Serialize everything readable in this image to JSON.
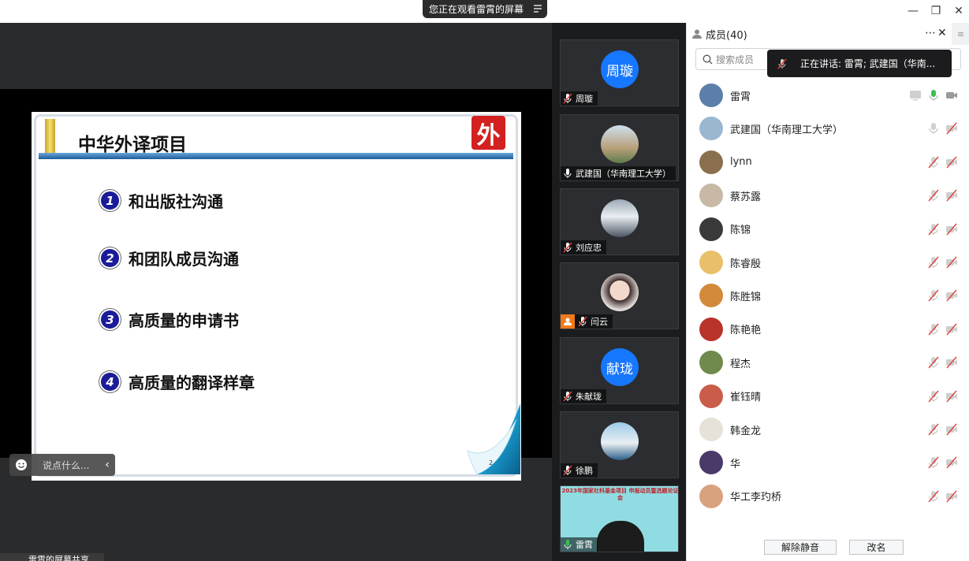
{
  "window": {
    "viewing_banner": "您正在观看雷霄的屏幕",
    "controls": [
      "minimize",
      "restore",
      "close"
    ]
  },
  "slide": {
    "title": "中华外译项目",
    "logo_text": "外",
    "bullets": [
      {
        "num": "1",
        "text": "和出版社沟通"
      },
      {
        "num": "2",
        "text": "和团队成员沟通"
      },
      {
        "num": "3",
        "text": "高质量的申请书"
      },
      {
        "num": "4",
        "text": "高质量的翻译样章"
      }
    ],
    "page_number": "2"
  },
  "chat": {
    "placeholder": "说点什么..."
  },
  "share_status": "雷霄的屏幕共享",
  "video_tiles": [
    {
      "name": "周璇",
      "avatar_text": "周璇",
      "avatar_color": "#1677ff",
      "mic": "muted"
    },
    {
      "name": "武建国（华南理工大学）",
      "avatar_text": "",
      "avatar_color": "#9bb7d0",
      "mic": "on"
    },
    {
      "name": "刘应忠",
      "avatar_text": "",
      "avatar_color": "#7c8a99",
      "mic": "muted"
    },
    {
      "name": "闫云",
      "avatar_text": "",
      "avatar_color": "#d9c2b8",
      "mic": "muted"
    },
    {
      "name": "朱献珑",
      "avatar_text": "献珑",
      "avatar_color": "#1677ff",
      "mic": "muted"
    },
    {
      "name": "徐鹏",
      "avatar_text": "",
      "avatar_color": "#3b79b5",
      "mic": "muted"
    },
    {
      "name": "雷霄",
      "avatar_text": "",
      "avatar_color": "#7fd1d8",
      "mic": "on",
      "video_banner": "2023年国家社科基金项目 申报动员暨选题论证会"
    }
  ],
  "members": {
    "header": "成员(40)",
    "search_placeholder": "搜索成员",
    "speaking_tip": "正在讲话: 雷霄; 武建国（华南...",
    "list": [
      {
        "name": "雷霄",
        "avatar_color": "#5b7fa8",
        "mic": "on",
        "video": "on",
        "screen": true
      },
      {
        "name": "武建国（华南理工大学）",
        "avatar_color": "#9bb7d0",
        "mic": "off",
        "video": "off"
      },
      {
        "name": "lynn",
        "avatar_color": "#8a6f4e",
        "mic": "off",
        "video": "off"
      },
      {
        "name": "蔡苏露",
        "avatar_color": "#c7b9a6",
        "mic": "off",
        "video": "off"
      },
      {
        "name": "陈锦",
        "avatar_color": "#3a3a3a",
        "mic": "off",
        "video": "off"
      },
      {
        "name": "陈睿殷",
        "avatar_color": "#e8c06a",
        "mic": "off",
        "video": "off"
      },
      {
        "name": "陈胜锦",
        "avatar_color": "#d28a3a",
        "mic": "off",
        "video": "off"
      },
      {
        "name": "陈艳艳",
        "avatar_color": "#b8342b",
        "mic": "off",
        "video": "off"
      },
      {
        "name": "程杰",
        "avatar_color": "#6f8a4c",
        "mic": "off",
        "video": "off"
      },
      {
        "name": "崔钰晴",
        "avatar_color": "#c95d4a",
        "mic": "off",
        "video": "off"
      },
      {
        "name": "韩金龙",
        "avatar_color": "#e6e2d8",
        "mic": "off",
        "video": "off"
      },
      {
        "name": "华",
        "avatar_color": "#4a3a6a",
        "mic": "off",
        "video": "off"
      },
      {
        "name": "华工李玓桥",
        "avatar_color": "#d8a27f",
        "mic": "off",
        "video": "off"
      }
    ]
  },
  "footer": {
    "unmute_all": "解除静音",
    "rename": "改名"
  },
  "colors": {
    "mic_on": "#3bbf55",
    "mic_off": "#e0403a",
    "accent": "#1677ff"
  }
}
